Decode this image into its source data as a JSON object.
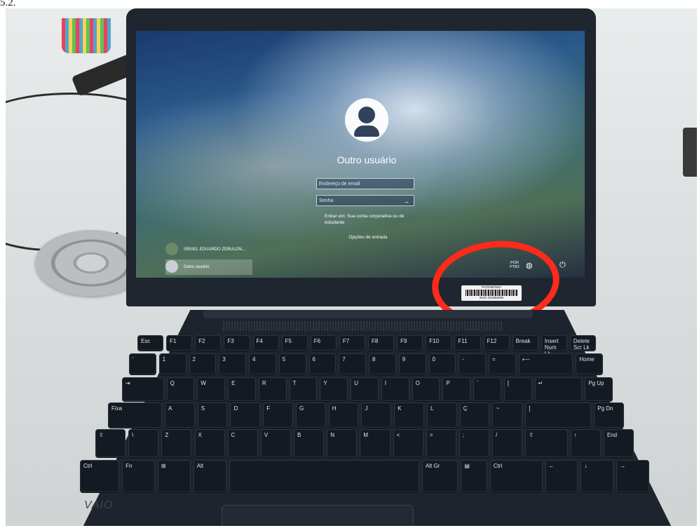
{
  "caption": "5.2.",
  "screen": {
    "title": "Outro usuário",
    "email_placeholder": "Endereço de email",
    "password_placeholder": "Senha",
    "submit_icon": "arrow-right-icon",
    "sign_in_to": "Entrar em: Sua conta corporativa ou de estudante",
    "sign_in_options": "Opções de entrada",
    "users": [
      {
        "name": "ISRAEL EDUARDO ZEBULON..."
      },
      {
        "name": "Outro usuário"
      }
    ],
    "language": {
      "line1": "POR",
      "line2": "PTB2"
    },
    "icons": {
      "network": "globe-icon",
      "power": "power-icon"
    }
  },
  "sticker": {
    "label": "PATRIMÔNIO",
    "prefix": "INSS",
    "number": "031884690"
  },
  "annotation_color": "#ff2a1a",
  "brand": "VAIO",
  "keyboard": {
    "fn_row": [
      "Esc",
      "F1",
      "F2",
      "F3",
      "F4",
      "F5",
      "F6",
      "F7",
      "F8",
      "F9",
      "F10",
      "F11",
      "F12",
      "Break",
      "Insert Num Lk",
      "Delete Scr Lk"
    ],
    "num_row": [
      "'",
      "1",
      "2",
      "3",
      "4",
      "5",
      "6",
      "7",
      "8",
      "9",
      "0",
      "-",
      "=",
      "⟵",
      "Home"
    ],
    "top_row": [
      "⇥",
      "Q",
      "W",
      "E",
      "R",
      "T",
      "Y",
      "U",
      "I",
      "O",
      "P",
      "´",
      "[",
      "↵",
      "Pg Up"
    ],
    "home_row": [
      "Fixa",
      "A",
      "S",
      "D",
      "F",
      "G",
      "H",
      "J",
      "K",
      "L",
      "Ç",
      "~",
      "]",
      "Pg Dn"
    ],
    "bottom_row": [
      "⇧",
      "\\",
      "Z",
      "X",
      "C",
      "V",
      "B",
      "N",
      "M",
      "<",
      ">",
      ";",
      "/",
      "⇧",
      "↑",
      "End"
    ],
    "space_row": [
      "Ctrl",
      "Fn",
      "⊞",
      "Alt",
      "",
      "Alt Gr",
      "▤",
      "Ctrl",
      "←",
      "↓",
      "→"
    ]
  }
}
